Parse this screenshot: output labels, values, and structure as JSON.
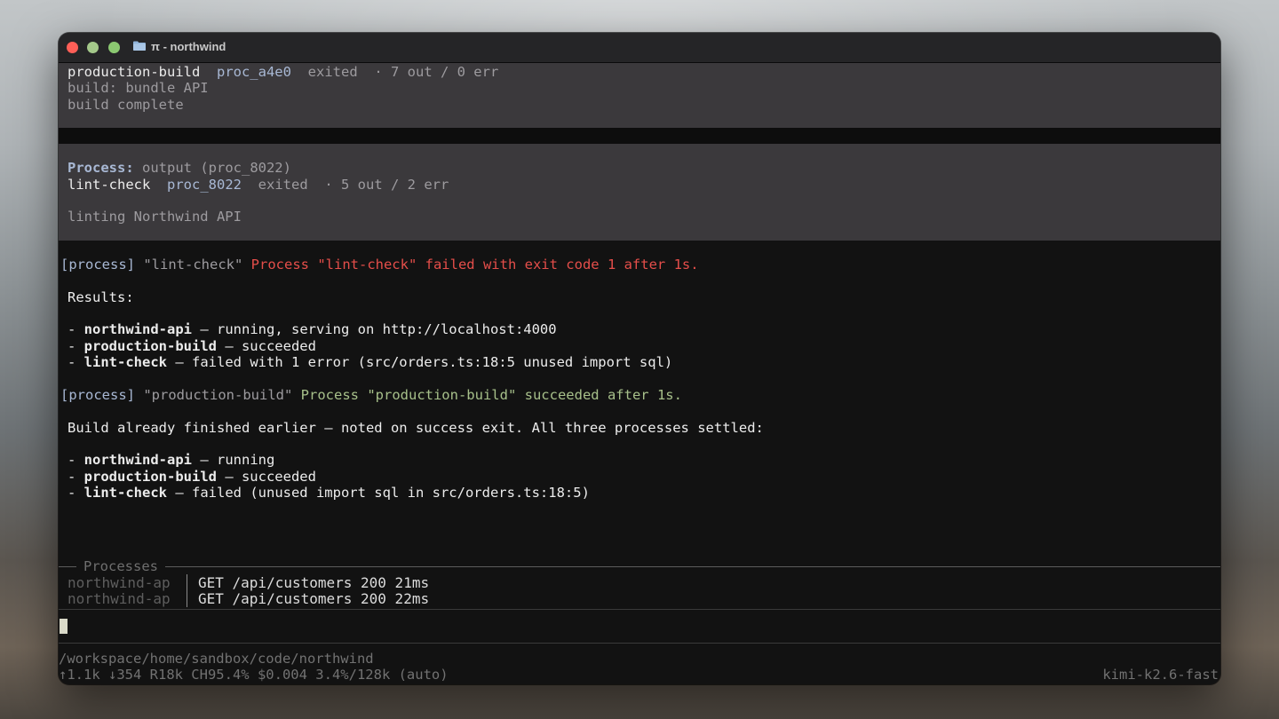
{
  "window": {
    "title": "π - northwind"
  },
  "top_block": {
    "name": "production-build",
    "proc_id": "proc_a4e0",
    "state": "exited",
    "counts": "· 7 out / 0 err",
    "lines": [
      "build: bundle API",
      "build complete"
    ]
  },
  "process_block": {
    "label": "Process:",
    "title": "output (proc_8022)",
    "name": "lint-check",
    "proc_id": "proc_8022",
    "state": "exited",
    "counts": "· 5 out / 2 err",
    "output": "linting Northwind API"
  },
  "messages": {
    "notice1": {
      "tag": "[process]",
      "target": "\"lint-check\"",
      "text": "Process \"lint-check\" failed with exit code 1 after 1s."
    },
    "results_heading": "Results:",
    "results": [
      {
        "name": "northwind-api",
        "desc": " — running, serving on http://localhost:4000"
      },
      {
        "name": "production-build",
        "desc": " — succeeded"
      },
      {
        "name": "lint-check",
        "desc": " — failed with 1 error (src/orders.ts:18:5 unused import sql)"
      }
    ],
    "notice2": {
      "tag": "[process]",
      "target": "\"production-build\"",
      "text": "Process \"production-build\" succeeded after 1s."
    },
    "summary": "Build already finished earlier — noted on success exit. All three processes settled:",
    "settled": [
      {
        "name": "northwind-api",
        "desc": " — running"
      },
      {
        "name": "production-build",
        "desc": " — succeeded"
      },
      {
        "name": "lint-check",
        "desc": " — failed (unused import sql in src/orders.ts:18:5)"
      }
    ]
  },
  "processes_panel": {
    "label": "Processes",
    "rows": [
      {
        "name": "northwind-ap",
        "msg": "GET /api/customers 200 21ms"
      },
      {
        "name": "northwind-ap",
        "msg": "GET /api/customers 200 22ms"
      }
    ]
  },
  "status_bar": {
    "path": "/workspace/home/sandbox/code/northwind",
    "stats": "↑1.1k ↓354 R18k CH95.4% $0.004 3.4%/128k (auto)",
    "model": "kimi-k2.6-fast"
  }
}
